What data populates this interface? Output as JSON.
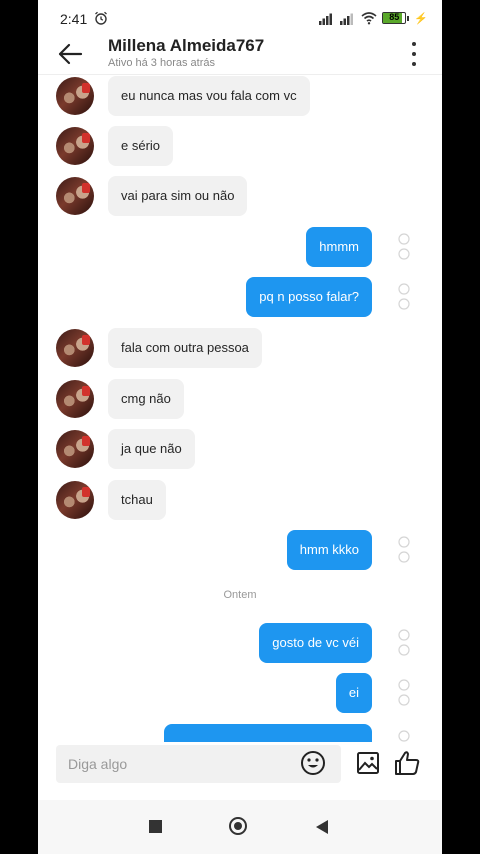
{
  "status_bar": {
    "time": "2:41",
    "battery": "85"
  },
  "header": {
    "contact_name": "Millena Almeida767",
    "contact_status": "Ativo há 3 horas atrás"
  },
  "messages": [
    {
      "dir": "in",
      "text": "eu nunca mas vou fala com vc"
    },
    {
      "dir": "in",
      "text": "e sério"
    },
    {
      "dir": "in",
      "text": "vai para sim ou não"
    },
    {
      "dir": "out",
      "text": "hmmm"
    },
    {
      "dir": "out",
      "text": "pq n posso falar?"
    },
    {
      "dir": "in",
      "text": "fala com outra pessoa"
    },
    {
      "dir": "in",
      "text": "cmg não"
    },
    {
      "dir": "in",
      "text": "ja que não"
    },
    {
      "dir": "in",
      "text": "tchau"
    },
    {
      "dir": "out",
      "text": "hmm kkko"
    },
    {
      "dir": "out",
      "text": "gosto de vc véi"
    },
    {
      "dir": "out",
      "text": "ei"
    },
    {
      "dir": "out",
      "text": ""
    }
  ],
  "date_separator": "Ontem",
  "composer": {
    "placeholder": "Diga algo"
  },
  "colors": {
    "outgoing_bubble": "#1e96f0",
    "incoming_bubble": "#f1f1f1"
  }
}
